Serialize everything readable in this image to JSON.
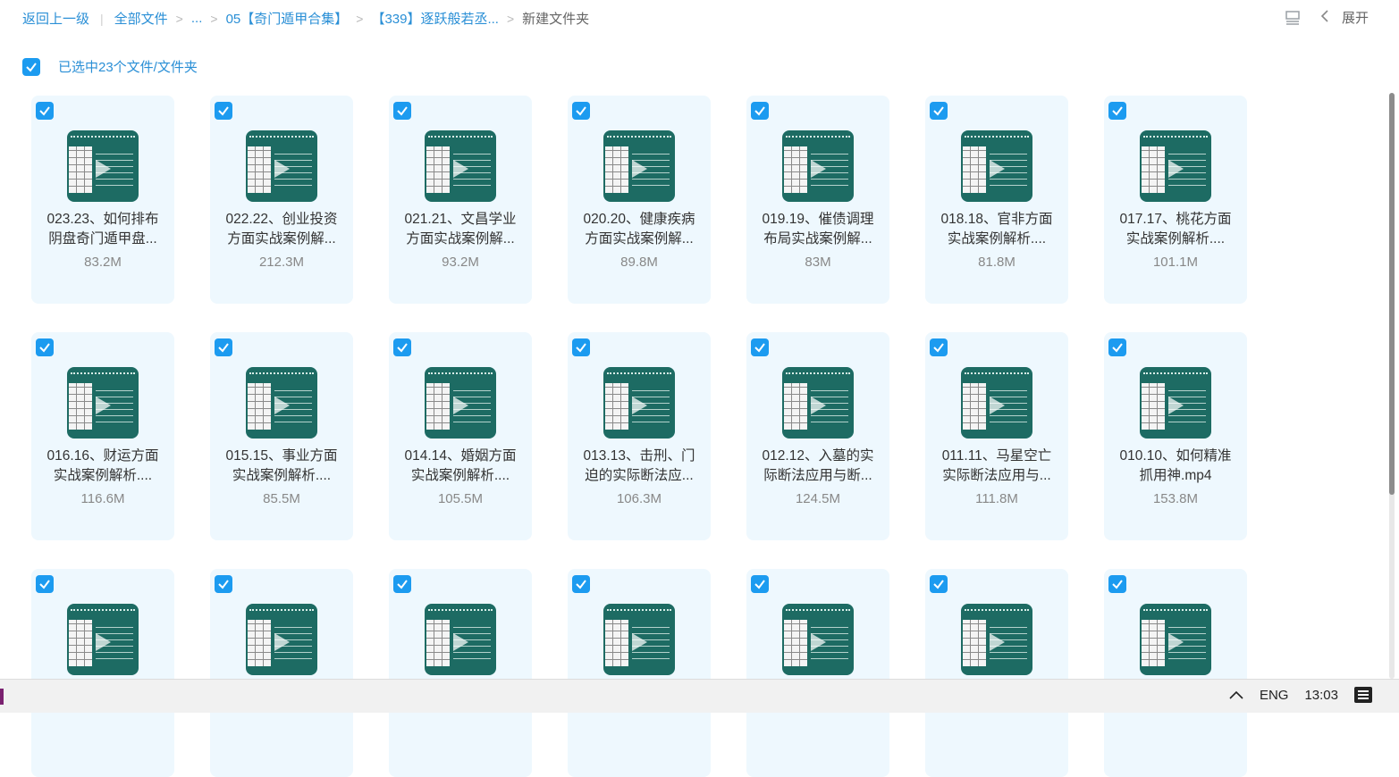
{
  "breadcrumb": {
    "back": "返回上一级",
    "all_files": "全部文件",
    "ellipsis": "...",
    "folder1": "05【奇门遁甲合集】",
    "folder2": "【339】逐跃般若丞...",
    "current": "新建文件夹"
  },
  "header": {
    "expand_label": "展开"
  },
  "selection": {
    "text": "已选中23个文件/文件夹"
  },
  "files": [
    {
      "line1": "023.23、如何排布",
      "line2": "阴盘奇门遁甲盘...",
      "size": "83.2M"
    },
    {
      "line1": "022.22、创业投资",
      "line2": "方面实战案例解...",
      "size": "212.3M"
    },
    {
      "line1": "021.21、文昌学业",
      "line2": "方面实战案例解...",
      "size": "93.2M"
    },
    {
      "line1": "020.20、健康疾病",
      "line2": "方面实战案例解...",
      "size": "89.8M"
    },
    {
      "line1": "019.19、催债调理",
      "line2": "布局实战案例解...",
      "size": "83M"
    },
    {
      "line1": "018.18、官非方面",
      "line2": "实战案例解析....",
      "size": "81.8M"
    },
    {
      "line1": "017.17、桃花方面",
      "line2": "实战案例解析....",
      "size": "101.1M"
    },
    {
      "line1": "016.16、财运方面",
      "line2": "实战案例解析....",
      "size": "116.6M"
    },
    {
      "line1": "015.15、事业方面",
      "line2": "实战案例解析....",
      "size": "85.5M"
    },
    {
      "line1": "014.14、婚姻方面",
      "line2": "实战案例解析....",
      "size": "105.5M"
    },
    {
      "line1": "013.13、击刑、门",
      "line2": "迫的实际断法应...",
      "size": "106.3M"
    },
    {
      "line1": "012.12、入墓的实",
      "line2": "际断法应用与断...",
      "size": "124.5M"
    },
    {
      "line1": "011.11、马星空亡",
      "line2": "实际断法应用与...",
      "size": "111.8M"
    },
    {
      "line1": "010.10、如何精准",
      "line2": "抓用神.mp4",
      "size": "153.8M"
    },
    {
      "line1": "",
      "line2": "",
      "size": ""
    },
    {
      "line1": "",
      "line2": "",
      "size": ""
    },
    {
      "line1": "",
      "line2": "",
      "size": ""
    },
    {
      "line1": "",
      "line2": "",
      "size": ""
    },
    {
      "line1": "",
      "line2": "",
      "size": ""
    },
    {
      "line1": "",
      "line2": "",
      "size": ""
    },
    {
      "line1": "",
      "line2": "",
      "size": ""
    }
  ],
  "taskbar": {
    "lang": "ENG",
    "time": "13:03"
  },
  "colors": {
    "accent": "#1c9bf0",
    "link": "#2a8fd6",
    "thumb_bg": "#1d6b63",
    "card_bg": "#eef8fe"
  }
}
